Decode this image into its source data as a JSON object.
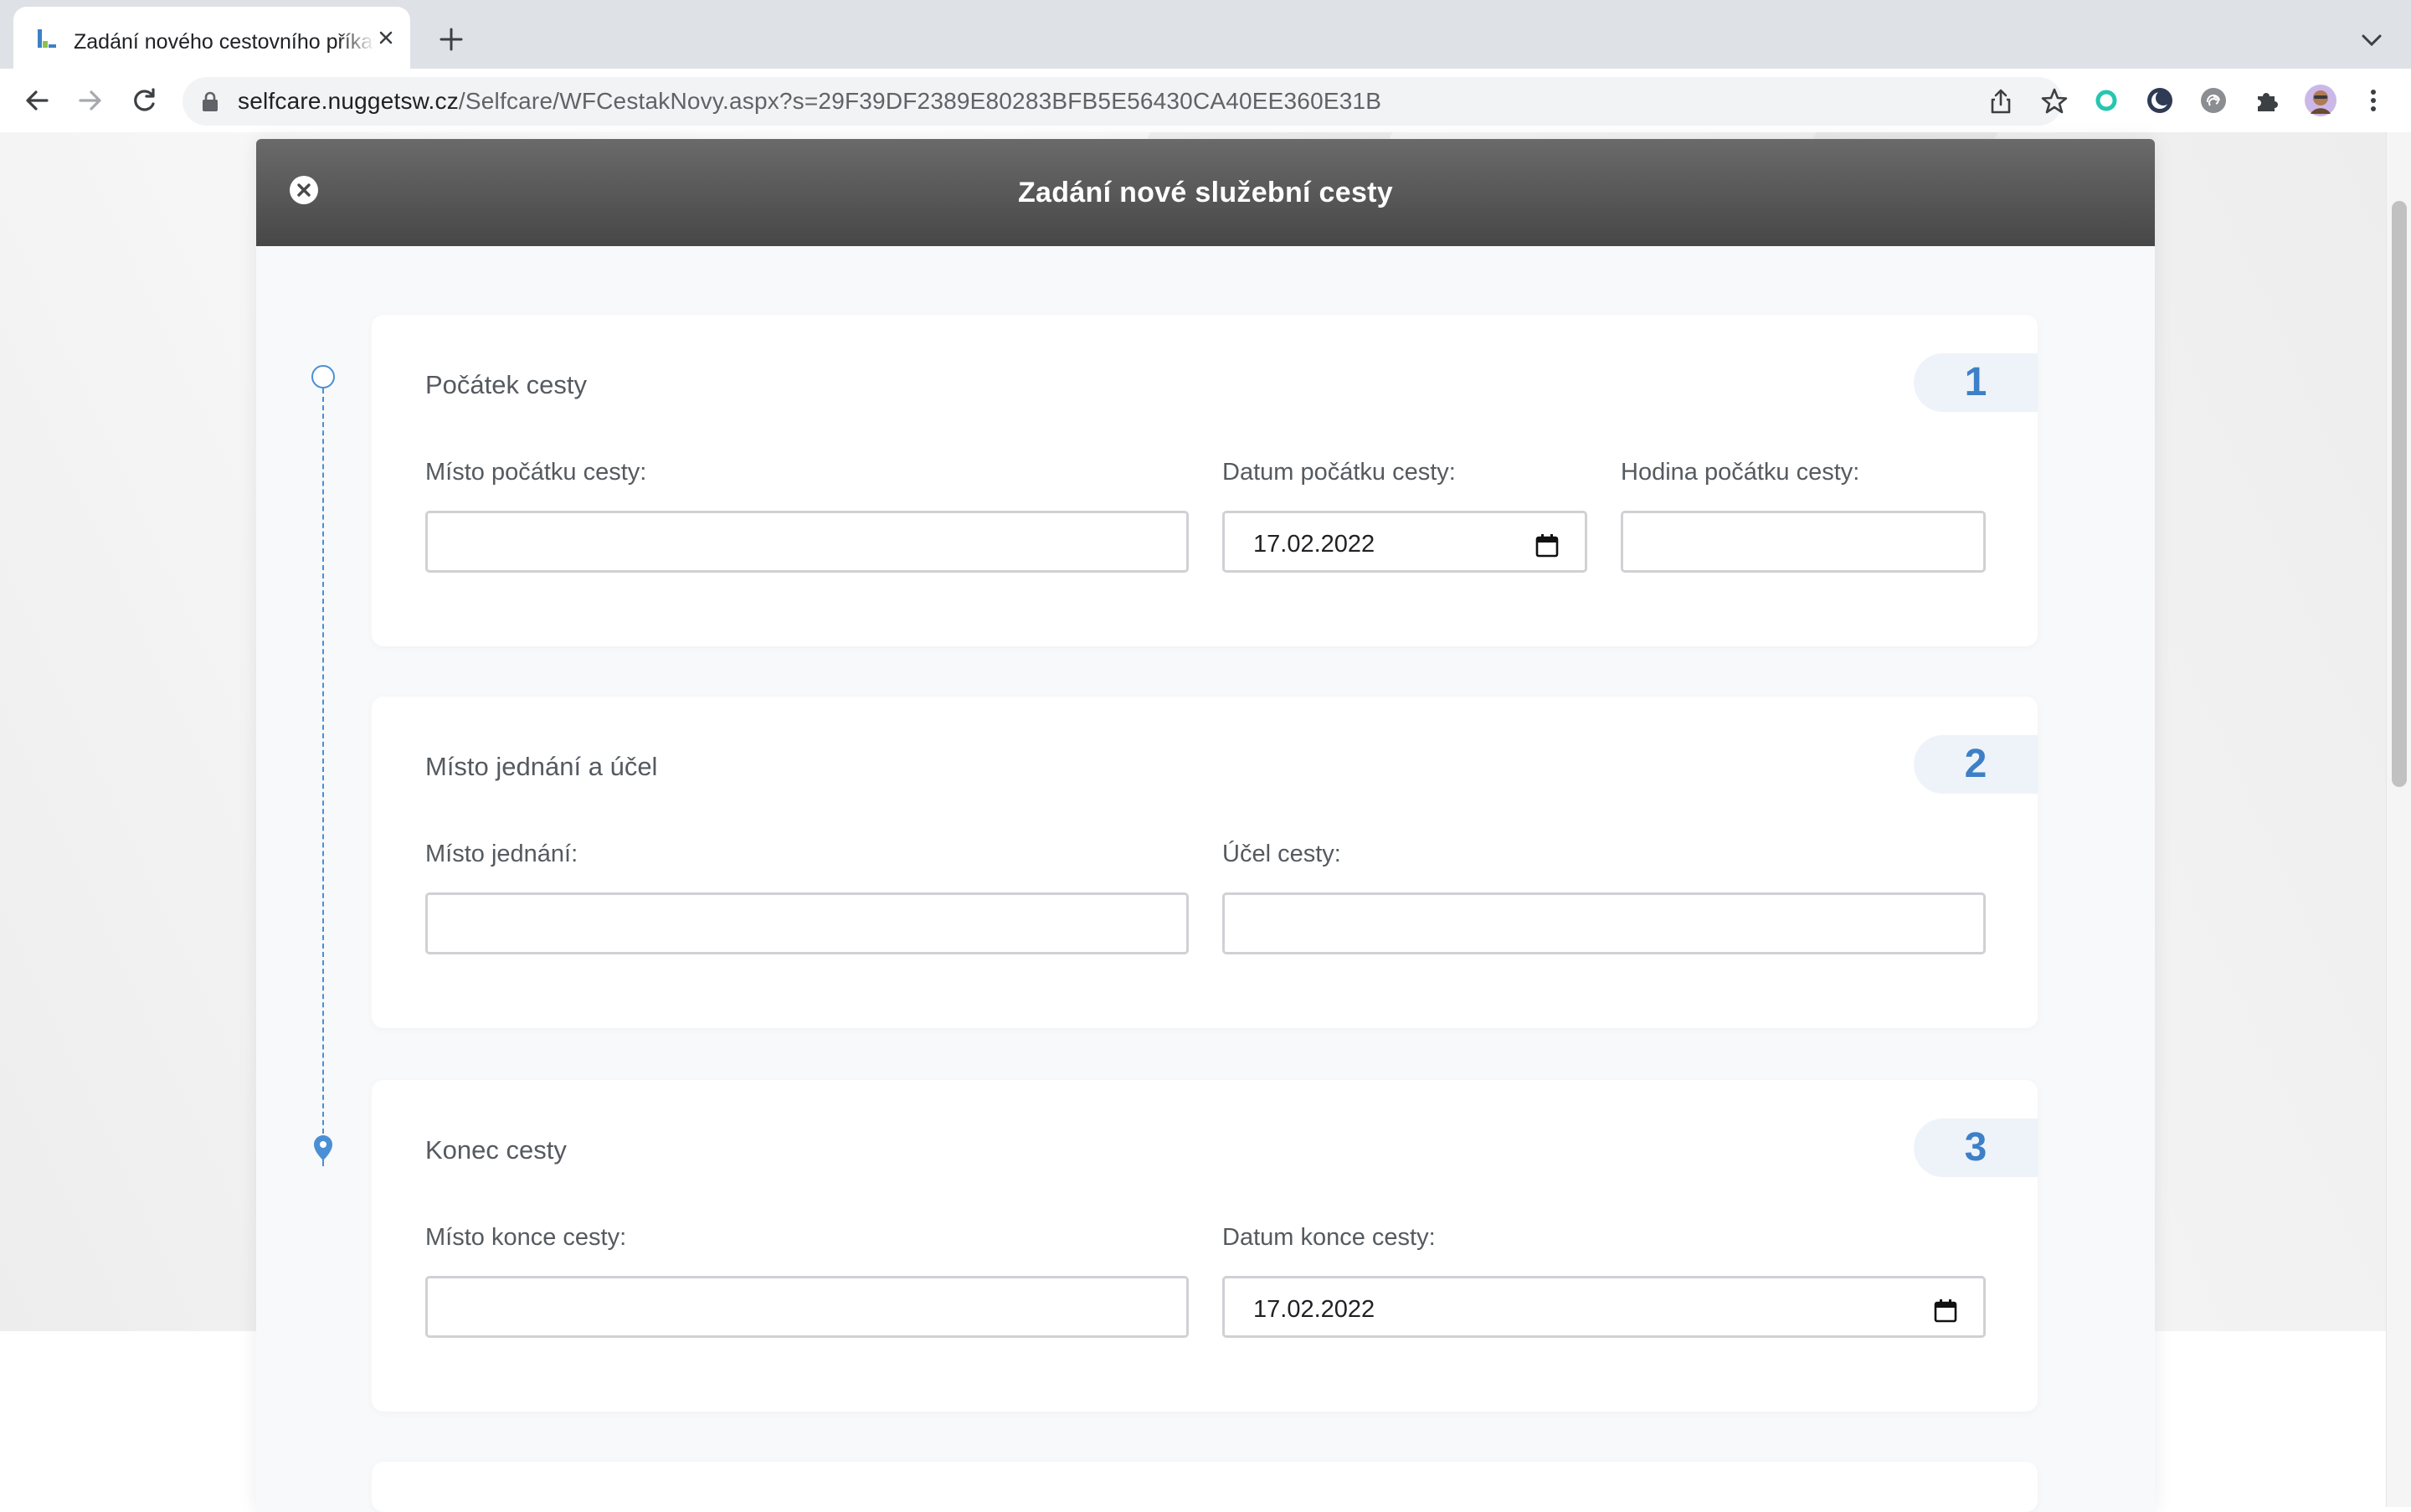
{
  "browser": {
    "tab_title": "Zadání nového cestovního příkazu",
    "url_host": "selfcare.nuggetsw.cz",
    "url_path": "/Selfcare/WFCestakNovy.aspx?s=29F39DF2389E80283BFB5E56430CA40EE360E31B"
  },
  "modal": {
    "title": "Zadání nové služební cesty"
  },
  "cards": {
    "start": {
      "step": "1",
      "title": "Počátek cesty",
      "place_label": "Místo počátku cesty:",
      "place_value": "",
      "date_label": "Datum počátku cesty:",
      "date_value": "17.02.2022",
      "hour_label": "Hodina počátku cesty:",
      "hour_value": ""
    },
    "meeting": {
      "step": "2",
      "title": "Místo jednání a účel",
      "place_label": "Místo jednání:",
      "place_value": "",
      "purpose_label": "Účel cesty:",
      "purpose_value": ""
    },
    "end": {
      "step": "3",
      "title": "Konec cesty",
      "place_label": "Místo konce cesty:",
      "place_value": "",
      "date_label": "Datum konce cesty:",
      "date_value": "17.02.2022"
    }
  },
  "colors": {
    "accent": "#3d80c7",
    "header_dark": "#474747"
  }
}
